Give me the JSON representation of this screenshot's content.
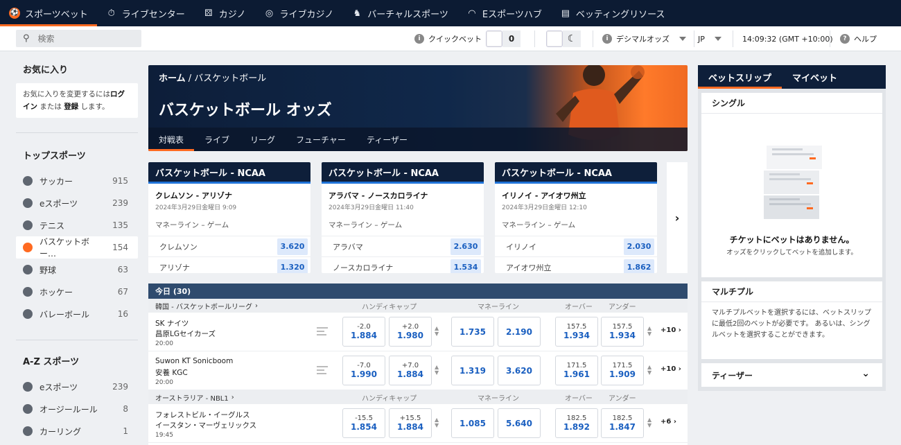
{
  "topnav": {
    "items": [
      {
        "label": "スポーツベット",
        "icon": "soccer-ball-icon"
      },
      {
        "label": "ライブセンター",
        "icon": "stopwatch-icon"
      },
      {
        "label": "カジノ",
        "icon": "dice-icon"
      },
      {
        "label": "ライブカジノ",
        "icon": "chip-icon"
      },
      {
        "label": "バーチャルスポーツ",
        "icon": "horse-icon"
      },
      {
        "label": "Eスポーツハブ",
        "icon": "headset-icon"
      },
      {
        "label": "ベッティングリソース",
        "icon": "document-icon"
      }
    ]
  },
  "subbar": {
    "search_placeholder": "検索",
    "quickbet_label": "クイックベット",
    "quickbet_count": "0",
    "odds_format": "デシマルオッズ",
    "language": "JP",
    "clock": "14:09:32 (GMT +10:00)",
    "help": "ヘルプ"
  },
  "sidebar": {
    "favorites_title": "お気に入り",
    "favorites_text_1": "お気に入りを変更するには",
    "favorites_login": "ログイン",
    "favorites_or": "または",
    "favorites_register": "登録",
    "favorites_text_2": "します。",
    "top_sports_title": "トップスポーツ",
    "top_sports": [
      {
        "label": "サッカー",
        "count": "915"
      },
      {
        "label": "eスポーツ",
        "count": "239"
      },
      {
        "label": "テニス",
        "count": "135"
      },
      {
        "label": "バスケットボー…",
        "count": "154"
      },
      {
        "label": "野球",
        "count": "63"
      },
      {
        "label": "ホッケー",
        "count": "67"
      },
      {
        "label": "バレーボール",
        "count": "16"
      }
    ],
    "az_title": "A-Z スポーツ",
    "az_sports": [
      {
        "label": "eスポーツ",
        "count": "239"
      },
      {
        "label": "オージールール",
        "count": "8"
      },
      {
        "label": "カーリング",
        "count": "1"
      }
    ]
  },
  "hero": {
    "breadcrumb_home": "ホーム",
    "breadcrumb_sep": " / ",
    "breadcrumb_current": "バスケットボール",
    "title": "バスケットボール オッズ",
    "tabs": [
      "対戦表",
      "ライブ",
      "リーグ",
      "フューチャー",
      "ティーザー"
    ]
  },
  "featured": [
    {
      "league": "バスケットボール - NCAA",
      "match": "クレムソン - アリゾナ",
      "date": "2024年3月29日金曜日 9:09",
      "market": "マネーライン – ゲーム",
      "team1": "クレムソン",
      "odd1": "3.620",
      "team2": "アリゾナ",
      "odd2": "1.320"
    },
    {
      "league": "バスケットボール - NCAA",
      "match": "アラバマ - ノースカロライナ",
      "date": "2024年3月29日金曜日 11:40",
      "market": "マネーライン – ゲーム",
      "team1": "アラバマ",
      "odd1": "2.630",
      "team2": "ノースカロライナ",
      "odd2": "1.534"
    },
    {
      "league": "バスケットボール - NCAA",
      "match": "イリノイ - アイオワ州立",
      "date": "2024年3月29日金曜日 12:10",
      "market": "マネーライン – ゲーム",
      "team1": "イリノイ",
      "odd1": "2.030",
      "team2": "アイオワ州立",
      "odd2": "1.862"
    }
  ],
  "today": {
    "title": "今日 (30)",
    "headers": {
      "handicap": "ハンディキャップ",
      "moneyline": "マネーライン",
      "over": "オーバー",
      "under": "アンダー"
    },
    "leagues": [
      {
        "name": "韓国 - バスケットボールリーグ",
        "matches": [
          {
            "team1": "SK ナイツ",
            "team2": "昌原LGセイカーズ",
            "time": "20:00",
            "hc1_line": "-2.0",
            "hc1": "1.884",
            "hc2_line": "+2.0",
            "hc2": "1.980",
            "ml1": "1.735",
            "ml2": "2.190",
            "ov_line": "157.5",
            "ov": "1.934",
            "un_line": "157.5",
            "un": "1.934",
            "more": "+10"
          },
          {
            "team1": "Suwon KT Sonicboom",
            "team2": "安養 KGC",
            "time": "20:00",
            "hc1_line": "-7.0",
            "hc1": "1.990",
            "hc2_line": "+7.0",
            "hc2": "1.884",
            "ml1": "1.319",
            "ml2": "3.620",
            "ov_line": "171.5",
            "ov": "1.961",
            "un_line": "171.5",
            "un": "1.909",
            "more": "+10"
          }
        ]
      },
      {
        "name": "オーストラリア - NBL1",
        "matches": [
          {
            "team1": "フォレストビル・イーグルス",
            "team2": "イースタン・マーヴェリックス",
            "time": "19:45",
            "hc1_line": "-15.5",
            "hc1": "1.854",
            "hc2_line": "+15.5",
            "hc2": "1.884",
            "ml1": "1.085",
            "ml2": "5.640",
            "ov_line": "182.5",
            "ov": "1.892",
            "un_line": "182.5",
            "un": "1.847",
            "more": "+6"
          }
        ]
      }
    ]
  },
  "betslip": {
    "tab_betslip": "ベットスリップ",
    "tab_mybets": "マイベット",
    "single_title": "シングル",
    "empty_title": "チケットにベットはありません。",
    "empty_sub": "オッズをクリックしてベットを追加します。",
    "multiple_title": "マルチプル",
    "multiple_text": "マルチプルベットを選択するには、ベットスリップに最低2回のベットが必要です。 あるいは、シングルベットを選択することができます。",
    "teaser_title": "ティーザー"
  },
  "colors": {
    "accent": "#ff6a21",
    "navy": "#0c1b33",
    "odds_blue": "#1a5fc0"
  }
}
